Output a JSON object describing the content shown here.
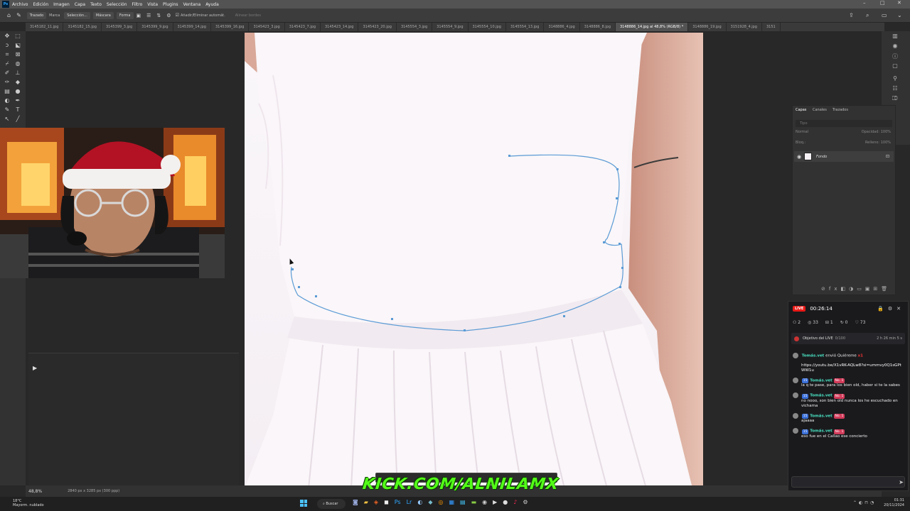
{
  "app": {
    "menu": [
      "Archivo",
      "Edición",
      "Imagen",
      "Capa",
      "Texto",
      "Selección",
      "Filtro",
      "Vista",
      "Plugins",
      "Ventana",
      "Ayuda"
    ],
    "window_controls": [
      "–",
      "□",
      "✕"
    ]
  },
  "options": {
    "tool_preset": "Trazado",
    "marca": "Marca",
    "seleccion": "Selección...",
    "mascara": "Máscara",
    "forma": "Forma",
    "auto_add": "Añadir/Eliminar automát.",
    "alinear": "Alinear bordes"
  },
  "tabs": [
    "3145182_11.jpg",
    "3145182_15.jpg",
    "3145399_3.jpg",
    "3145399_9.jpg",
    "3145399_14.jpg",
    "3145399_16.jpg",
    "3145423_3.jpg",
    "3145423_7.jpg",
    "3145423_14.jpg",
    "3145423_20.jpg",
    "3145554_3.jpg",
    "3145554_9.jpg",
    "3145554_10.jpg",
    "3145554_13.jpg",
    "3148886_4.jpg",
    "3148886_8.jpg",
    "3148886_14.jpg al 48,8% (RGB/8) *",
    "3148886_19.jpg",
    "3151928_4.jpg",
    "3151"
  ],
  "active_tab_index": 16,
  "layers": {
    "tabs": [
      "Capas",
      "Canales",
      "Trazados"
    ],
    "search_placeholder": "Tipo",
    "blend_mode": "Normal",
    "opacity_label": "Opacidad:",
    "opacity": "100%",
    "fill_label": "Relleno:",
    "fill": "100%",
    "lock_label": "Bloq.:",
    "layer_name": "Fondo"
  },
  "status": {
    "zoom": "48,8%",
    "doc_info": "2840 px x 3285 px (300 ppp)"
  },
  "stream": {
    "live_badge": "LIVE",
    "timer": "00:26:14",
    "stats": [
      "2",
      "33",
      "1",
      "0",
      "73"
    ],
    "goal": "Objetivo del LIVE",
    "goal_sub": "0/100",
    "goal_time": "2 h 26 min 5 s",
    "gift_user": "Tomás.vet",
    "gift_text": "envió Quiéreme",
    "gift_count": "x1",
    "link": "https://youtu.be/X1vRK-AQLw8?si=ummvy0Q1sGPtWW1u",
    "badge_level": "15",
    "badge_rank": "No. 1",
    "messages": [
      {
        "user": "Tomás.vet",
        "text": "la q te pase, para los bien old, haber si te la sabes"
      },
      {
        "user": "Tomás.vet",
        "text": "no nooo, son bien old nunca los he escuchado en vichama"
      },
      {
        "user": "Tomás.vet",
        "text": "ajaaaa"
      },
      {
        "user": "Tomás.vet",
        "text": "eso fue en el Callao ese concierto"
      }
    ]
  },
  "overlay": {
    "kick_url": "KICK.COM/ALNILAMX"
  },
  "taskbar": {
    "temp": "18°C",
    "weather": "Mayorm. nublado",
    "search": "Buscar",
    "time": "01:31",
    "date": "20/11/2024"
  },
  "colors": {
    "path": "#5b9bd5",
    "kick_green": "#53fc18",
    "live_red": "#e91916"
  }
}
